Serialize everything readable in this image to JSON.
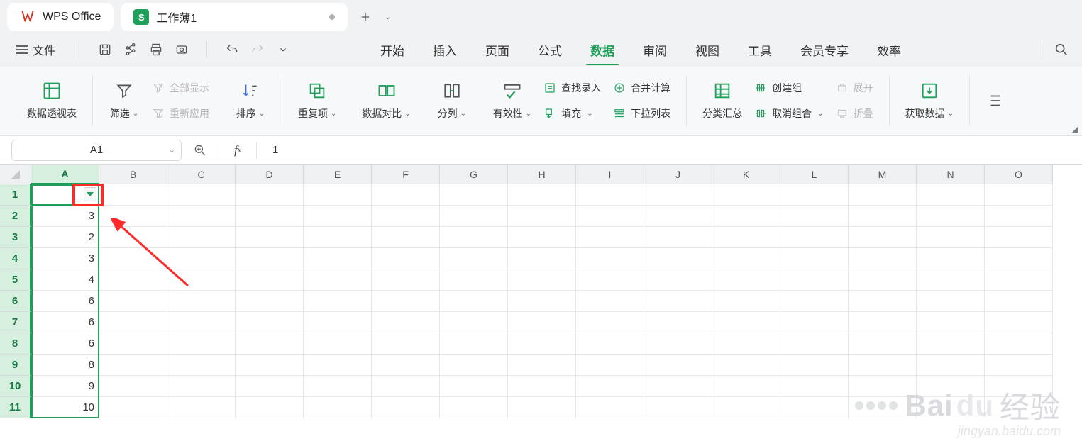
{
  "app": {
    "name": "WPS Office"
  },
  "document": {
    "title": "工作薄1"
  },
  "menu": {
    "file": "文件",
    "tabs": [
      "开始",
      "插入",
      "页面",
      "公式",
      "数据",
      "审阅",
      "视图",
      "工具",
      "会员专享",
      "效率"
    ],
    "active_tab": "数据"
  },
  "ribbon": {
    "pivot": "数据透视表",
    "filter": "筛选",
    "show_all": "全部显示",
    "reapply": "重新应用",
    "sort": "排序",
    "dup": "重复项",
    "compare": "数据对比",
    "split": "分列",
    "validity": "有效性",
    "find_input": "查找录入",
    "fill": "填充",
    "consolidate": "合并计算",
    "dropdown_list": "下拉列表",
    "subtotal": "分类汇总",
    "group": "创建组",
    "ungroup": "取消组合",
    "expand": "展开",
    "collapse": "折叠",
    "get_data": "获取数据"
  },
  "formula_bar": {
    "namebox": "A1",
    "value": "1"
  },
  "columns": [
    "A",
    "B",
    "C",
    "D",
    "E",
    "F",
    "G",
    "H",
    "I",
    "J",
    "K",
    "L",
    "M",
    "N",
    "O"
  ],
  "rows": [
    1,
    2,
    3,
    4,
    5,
    6,
    7,
    8,
    9,
    10,
    11
  ],
  "cells_colA": [
    "",
    "3",
    "2",
    "3",
    "4",
    "6",
    "6",
    "6",
    "8",
    "9",
    "10"
  ],
  "watermark": {
    "brand": "Bai",
    "du": "du",
    "text": "经验",
    "url": "jingyan.baidu.com"
  }
}
